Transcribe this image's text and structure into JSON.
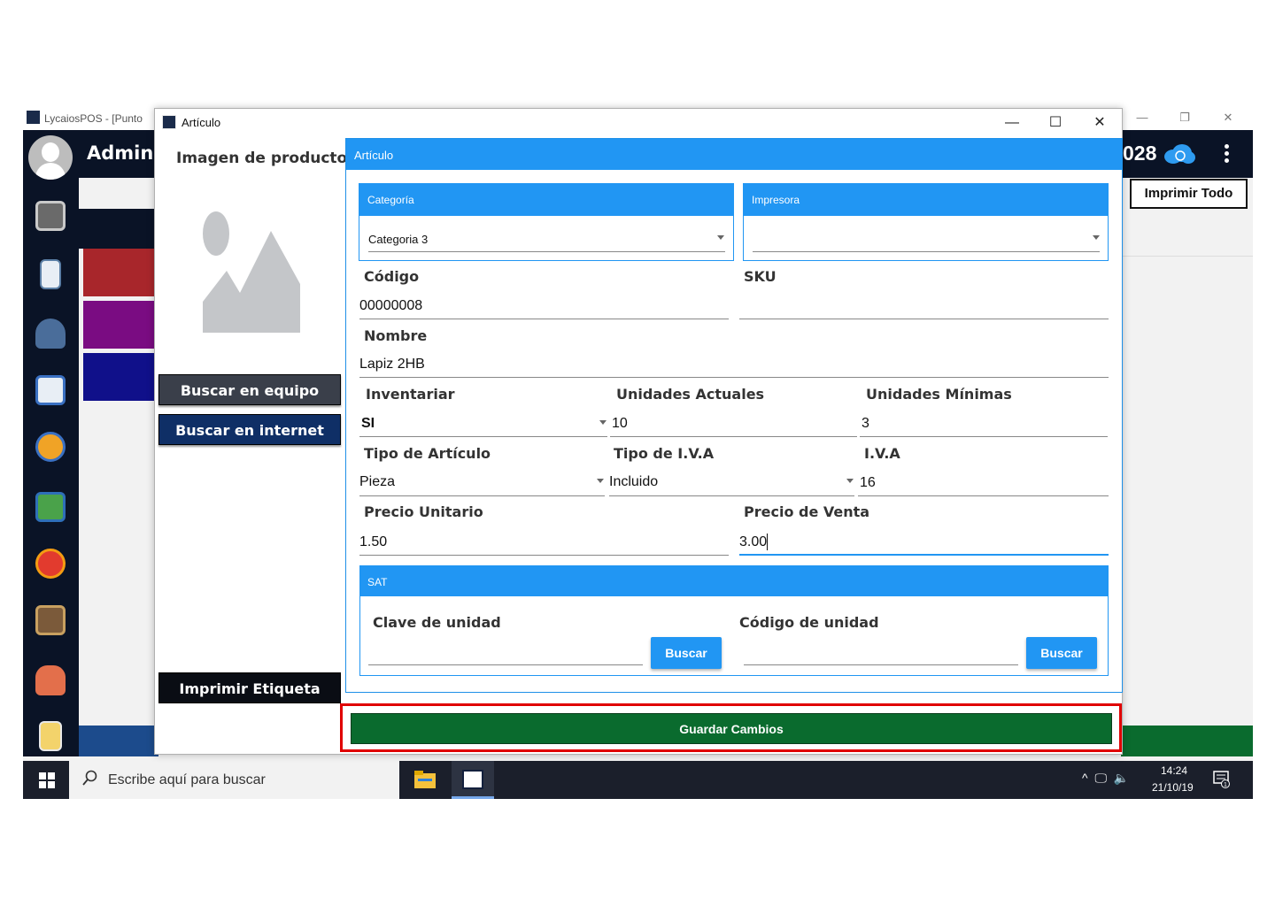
{
  "background_app": {
    "title": "LycaiosPOS - [Punto",
    "user_name": "Adminis",
    "header_number": "028",
    "print_all_label": "Imprimir Todo",
    "tile_colors": [
      "#a8262b",
      "#7a0c82",
      "#10108a"
    ],
    "sidebar_icons": [
      "cash-register-icon",
      "notebook-icon",
      "users-icon",
      "report-clock-icon",
      "top-badge-icon",
      "money-icon",
      "alarm-clock-icon",
      "inventory-shelf-icon",
      "customers-icon",
      "document-icon"
    ]
  },
  "taskbar": {
    "search_placeholder": "Escribe aquí para buscar",
    "time": "14:24",
    "date": "21/10/19",
    "tray": "^ 🖵 🔈",
    "notification_count": "1"
  },
  "dialog": {
    "title": "Artículo",
    "image_label": "Imagen de producto",
    "buttons": {
      "search_device": "Buscar en equipo",
      "search_internet": "Buscar en internet",
      "print_label": "Imprimir Etiqueta",
      "save": "Guardar Cambios"
    },
    "card_title": "Artículo",
    "categoria": {
      "header": "Categoría",
      "value": "Categoria 3"
    },
    "impresora": {
      "header": "Impresora",
      "value": ""
    },
    "codigo": {
      "label": "Código",
      "value": "00000008"
    },
    "sku": {
      "label": "SKU",
      "value": ""
    },
    "nombre": {
      "label": "Nombre",
      "value": "Lapiz 2HB"
    },
    "inventariar": {
      "label": "Inventariar",
      "value": "SI"
    },
    "unidades_actuales": {
      "label": "Unidades Actuales",
      "value": "10"
    },
    "unidades_minimas": {
      "label": "Unidades Mínimas",
      "value": "3"
    },
    "tipo_articulo": {
      "label": "Tipo de Artículo",
      "value": "Pieza"
    },
    "tipo_iva": {
      "label": "Tipo de I.V.A",
      "value": "Incluido"
    },
    "iva": {
      "label": "I.V.A",
      "value": "16"
    },
    "precio_unitario": {
      "label": "Precio Unitario",
      "value": "1.50"
    },
    "precio_venta": {
      "label": "Precio de Venta",
      "value": "3.00"
    },
    "sat": {
      "header": "SAT",
      "clave_label": "Clave de unidad",
      "clave_value": "",
      "codigo_label": "Código de unidad",
      "codigo_value": "",
      "buscar_label": "Buscar"
    }
  },
  "colors": {
    "accent": "#2196f3",
    "save_green": "#0a6b2e",
    "highlight": "#e00000",
    "navy": "#0a1326"
  }
}
